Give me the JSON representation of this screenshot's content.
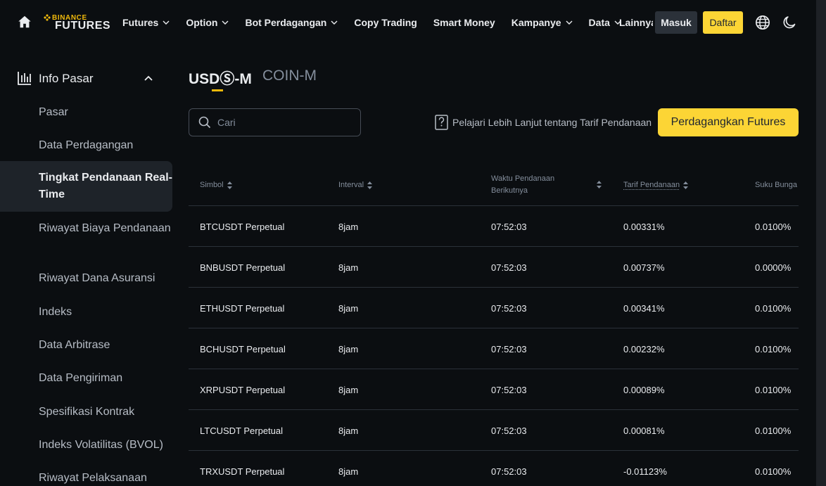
{
  "nav": {
    "brand_top": "BINANCE",
    "brand_bottom": "FUTURES",
    "items": [
      {
        "label": "Futures",
        "dropdown": true
      },
      {
        "label": "Option",
        "dropdown": true
      },
      {
        "label": "Bot Perdagangan",
        "dropdown": true
      },
      {
        "label": "Copy Trading",
        "dropdown": false
      },
      {
        "label": "Smart Money",
        "dropdown": false
      },
      {
        "label": "Kampanye",
        "dropdown": true
      },
      {
        "label": "Data",
        "dropdown": true
      }
    ],
    "more_label": "Lainnya",
    "login_label": "Masuk",
    "register_label": "Daftar"
  },
  "sidebar": {
    "section_title": "Info Pasar",
    "items": [
      "Pasar",
      "Data Perdagangan",
      "Tingkat Pendanaan Real-Time",
      "Riwayat Biaya Pendanaan",
      "Riwayat Dana Asuransi",
      "Indeks",
      "Data Arbitrase",
      "Data Pengiriman",
      "Spesifikasi Kontrak",
      "Indeks Volatilitas (BVOL)",
      "Riwayat Pelaksanaan"
    ],
    "active_index": 2
  },
  "tabs": {
    "usd": "USDⓈ-M",
    "coin": "COIN-M"
  },
  "search": {
    "placeholder": "Cari",
    "value": ""
  },
  "learn_more": "Pelajari Lebih Lanjut tentang Tarif Pendanaan",
  "trade_button": "Perdagangkan Futures",
  "table": {
    "headers": {
      "symbol": "Simbol",
      "interval": "Interval",
      "next_time": "Waktu Pendanaan Berikutnya",
      "rate": "Tarif Pendanaan",
      "interest": "Suku Bunga"
    },
    "rows": [
      {
        "symbol": "BTCUSDT Perpetual",
        "interval": "8jam",
        "time": "07:52:03",
        "rate": "0.00331%",
        "interest": "0.0100%"
      },
      {
        "symbol": "BNBUSDT Perpetual",
        "interval": "8jam",
        "time": "07:52:03",
        "rate": "0.00737%",
        "interest": "0.0000%"
      },
      {
        "symbol": "ETHUSDT Perpetual",
        "interval": "8jam",
        "time": "07:52:03",
        "rate": "0.00341%",
        "interest": "0.0100%"
      },
      {
        "symbol": "BCHUSDT Perpetual",
        "interval": "8jam",
        "time": "07:52:03",
        "rate": "0.00232%",
        "interest": "0.0100%"
      },
      {
        "symbol": "XRPUSDT Perpetual",
        "interval": "8jam",
        "time": "07:52:03",
        "rate": "0.00089%",
        "interest": "0.0100%"
      },
      {
        "symbol": "LTCUSDT Perpetual",
        "interval": "8jam",
        "time": "07:52:03",
        "rate": "0.00081%",
        "interest": "0.0100%"
      },
      {
        "symbol": "TRXUSDT Perpetual",
        "interval": "8jam",
        "time": "07:52:03",
        "rate": "-0.01123%",
        "interest": "0.0100%"
      }
    ]
  },
  "colors": {
    "background": "#0b0e11",
    "accent": "#fcd535",
    "brand_yellow": "#f0b90b",
    "active_bg": "#1e2329",
    "muted_text": "#848e9c"
  }
}
